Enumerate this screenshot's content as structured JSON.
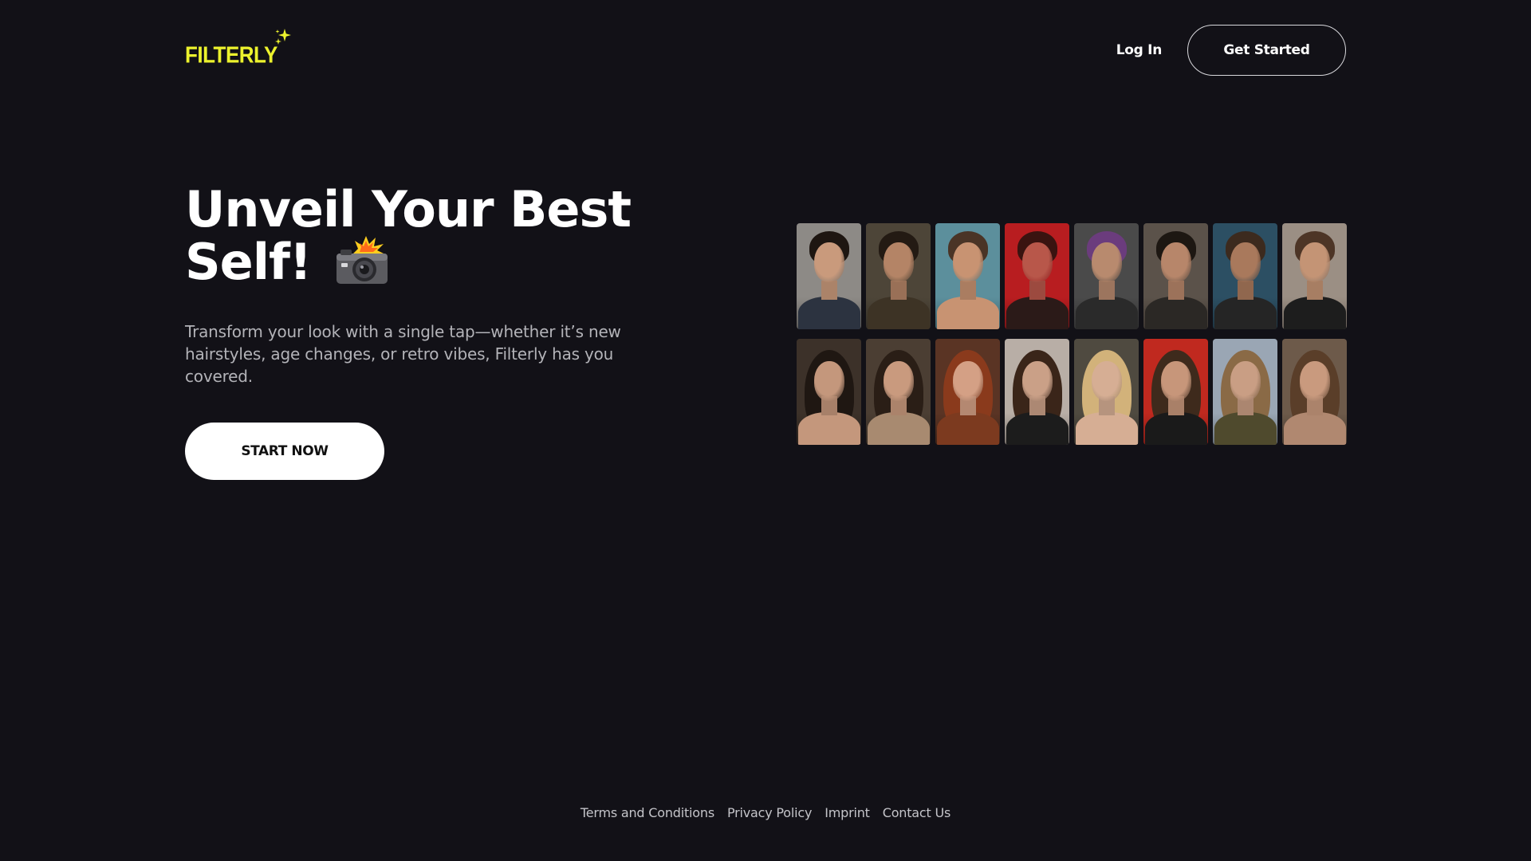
{
  "brand": {
    "name": "FILTERLY",
    "logo_color": "#ecf22d",
    "sparkle_icon": "sparkle-icon"
  },
  "nav": {
    "login_label": "Log In",
    "get_started_label": "Get Started"
  },
  "hero": {
    "title_line1": "Unveil Your Best",
    "title_line2": "Self!",
    "title_icon": "camera-flash-icon",
    "subtitle": "Transform your look with a single tap—whether it’s new hairstyles, age changes, or retro vibes, Filterly has you covered.",
    "cta_label": "START NOW"
  },
  "gallery": {
    "rows": [
      [
        {
          "bg": "#8d8a86",
          "hair": "#1e1611",
          "skin": "#c99a7c",
          "top": "#2c3340"
        },
        {
          "bg": "#4d4538",
          "hair": "#231a13",
          "skin": "#b48466",
          "top": "#3d3325"
        },
        {
          "bg": "#5c8f9c",
          "hair": "#4a3426",
          "skin": "#c89372",
          "top": "#c89372"
        },
        {
          "bg": "#b81d20",
          "hair": "#3a1310",
          "skin": "#b8574a",
          "top": "#2b1a18"
        },
        {
          "bg": "#4a4a4a",
          "hair": "#6b3c7d",
          "skin": "#b88a6e",
          "top": "#2a2a2a"
        },
        {
          "bg": "#5b524a",
          "hair": "#1d1712",
          "skin": "#b7866a",
          "top": "#2b2825"
        },
        {
          "bg": "#2c4f63",
          "hair": "#3c2a1e",
          "skin": "#a9795c",
          "top": "#252525"
        },
        {
          "bg": "#9b8f84",
          "hair": "#4d3526",
          "skin": "#c49475",
          "top": "#1d1d1d"
        }
      ],
      [
        {
          "bg": "#3c3129",
          "hair": "#1f1712",
          "skin": "#c4977c",
          "top": "#c4977c"
        },
        {
          "bg": "#4b3e33",
          "hair": "#2a1e16",
          "skin": "#c99a7e",
          "top": "#a88a70"
        },
        {
          "bg": "#5a3424",
          "hair": "#8a3a1c",
          "skin": "#d4a085",
          "top": "#7c3a1f"
        },
        {
          "bg": "#b8aea6",
          "hair": "#3a2519",
          "skin": "#caa087",
          "top": "#1c1c1c"
        },
        {
          "bg": "#4f4a40",
          "hair": "#d2b27a",
          "skin": "#d6ae94",
          "top": "#d6ae94"
        },
        {
          "bg": "#c0291f",
          "hair": "#3e2a1c",
          "skin": "#c7967a",
          "top": "#1a1a1a"
        },
        {
          "bg": "#9aa6b4",
          "hair": "#8a6a46",
          "skin": "#c99e84",
          "top": "#4f4a2d"
        },
        {
          "bg": "#6d5a4a",
          "hair": "#5a3e29",
          "skin": "#c99a7e",
          "top": "#b08870"
        }
      ]
    ]
  },
  "footer": {
    "links": [
      "Terms and Conditions",
      "Privacy Policy",
      "Imprint",
      "Contact Us"
    ]
  }
}
